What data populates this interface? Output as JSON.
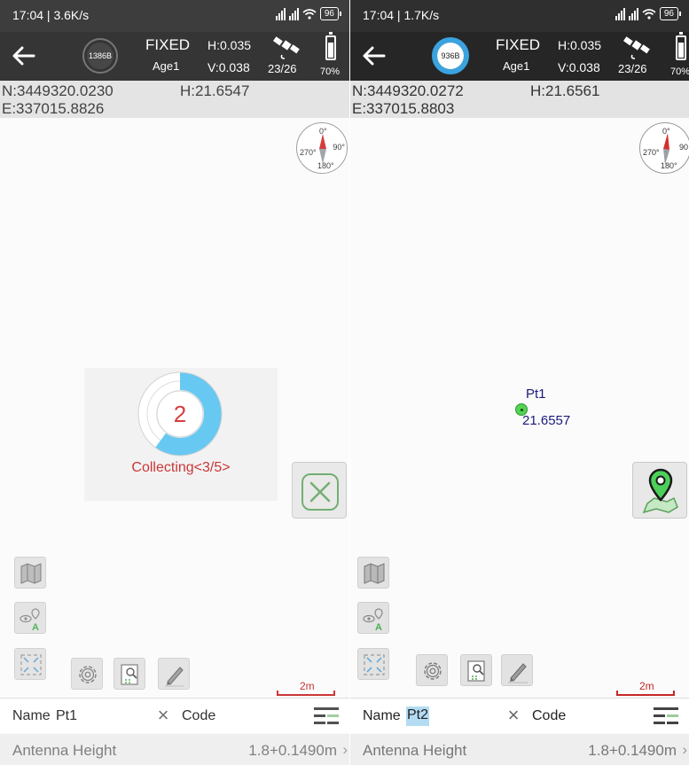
{
  "screens": [
    {
      "status_time": "17:04 | 3.6K/s",
      "battery_badge": "96",
      "header": {
        "data_size": "1386B",
        "fix_status": "FIXED",
        "age": "Age1",
        "h_precision": "H:0.035",
        "v_precision": "V:0.038",
        "satellites": "23/26",
        "battery": "70%"
      },
      "coords": {
        "north": "N:3449320.0230",
        "east": "E:337015.8826",
        "height": "H:21.6547"
      },
      "compass": {
        "n": "0°",
        "e": "90°",
        "s": "180°",
        "w": "270°"
      },
      "collecting": {
        "count": "2",
        "label": "Collecting<3/5>",
        "progress": 0.6
      },
      "scale": "2m",
      "form": {
        "name_label": "Name",
        "name_value": "Pt1",
        "code_label": "Code",
        "code_value": "",
        "antenna_label": "Antenna Height",
        "antenna_value": "1.8+0.1490m"
      }
    },
    {
      "status_time": "17:04 | 1.7K/s",
      "battery_badge": "96",
      "header": {
        "data_size": "936B",
        "fix_status": "FIXED",
        "age": "Age1",
        "h_precision": "H:0.035",
        "v_precision": "V:0.038",
        "satellites": "23/26",
        "battery": "70%"
      },
      "coords": {
        "north": "N:3449320.0272",
        "east": "E:337015.8803",
        "height": "H:21.6561"
      },
      "compass": {
        "n": "0°",
        "e": "90",
        "s": "180°",
        "w": "270°"
      },
      "map_point": {
        "name": "Pt1",
        "height": "21.6557"
      },
      "scale": "2m",
      "form": {
        "name_label": "Name",
        "name_value": "Pt2",
        "code_label": "Code",
        "code_value": "",
        "antenna_label": "Antenna Height",
        "antenna_value": "1.8+0.1490m"
      }
    }
  ],
  "icons": {
    "back": "back-arrow-icon",
    "satellite": "satellite-icon",
    "battery": "battery-icon",
    "compass": "compass-icon",
    "cancel": "close-icon",
    "add_point": "map-pin-icon",
    "map_layers": "map-icon",
    "point_view": "eye-pin-icon",
    "zoom_extent": "expand-icon",
    "settings": "gear-icon",
    "survey_data": "document-search-icon",
    "edit": "pencil-icon",
    "list": "list-icon"
  },
  "colors": {
    "header_bg": "#262626",
    "ring_progress": "#5cc4f2",
    "collecting_text": "#c62828",
    "point_fill": "#55d255",
    "point_label": "#1a1a7a",
    "scale_bar": "#c62828"
  }
}
